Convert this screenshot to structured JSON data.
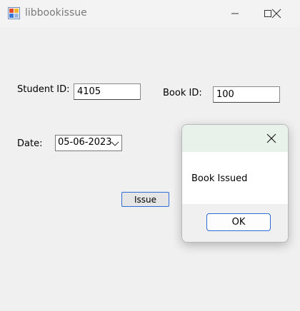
{
  "window": {
    "title": "libbookissue"
  },
  "form": {
    "student_id_label": "Student ID:",
    "student_id_value": "4105",
    "book_id_label": "Book ID:",
    "book_id_value": "100",
    "date_label": "Date:",
    "date_value": "05-06-2023",
    "issue_button": "Issue"
  },
  "dialog": {
    "message": "Book Issued",
    "ok_button": "OK"
  },
  "icons": {
    "app": "app-form-icon",
    "minimize": "minimize-icon",
    "maximize": "maximize-icon",
    "close": "close-icon",
    "dropdown": "chevron-down-icon"
  },
  "colors": {
    "accent": "#2d6bd6",
    "dialog_header": "#e9f2ea"
  }
}
